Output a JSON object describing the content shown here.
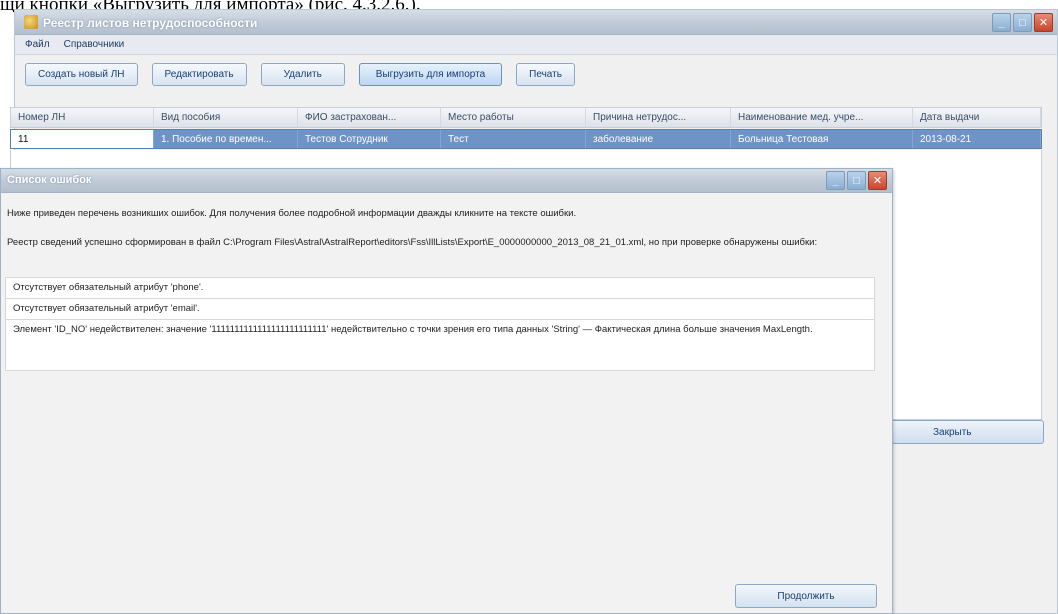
{
  "doc_text": "щи кнопки «Выгрузить для импорта» (рис. 4.3.2.6.).",
  "main_window": {
    "title": "Реестр листов нетрудоспособности",
    "menu": [
      "Файл",
      "Справочники"
    ],
    "toolbar": {
      "create": "Создать новый ЛН",
      "edit": "Редактировать",
      "delete": "Удалить",
      "export": "Выгрузить для импорта",
      "print": "Печать"
    },
    "grid": {
      "columns": [
        "Номер ЛН",
        "Вид пособия",
        "ФИО застрахован...",
        "Место работы",
        "Причина нетрудос...",
        "Наименование мед. учре...",
        "Дата выдачи"
      ],
      "rows": [
        [
          "11",
          "1. Пособие по времен...",
          "Тестов Сотрудник",
          "Тест",
          "заболевание",
          "Больница Тестовая",
          "2013-08-21"
        ]
      ]
    },
    "close_label": "Закрыть"
  },
  "dialog": {
    "title": "Список ошибок",
    "intro": "Ниже приведен перечень возникших ошибок. Для получения более подробной информации дважды кликните на тексте ошибки.",
    "result": "Реестр сведений успешно сформирован в файл C:\\Program Files\\Astral\\AstralReport\\editors\\Fss\\IllLists\\Export\\E_0000000000_2013_08_21_01.xml, но при проверке обнаружены ошибки:",
    "errors": [
      "Отсутствует обязательный атрибут 'phone'.",
      "Отсутствует обязательный атрибут 'email'.",
      "Элемент 'ID_NO' недействителен: значение '1111111111111111111111111' недействительно с точки зрения его типа данных 'String' — Фактическая длина больше значения MaxLength."
    ],
    "continue_label": "Продолжить"
  }
}
